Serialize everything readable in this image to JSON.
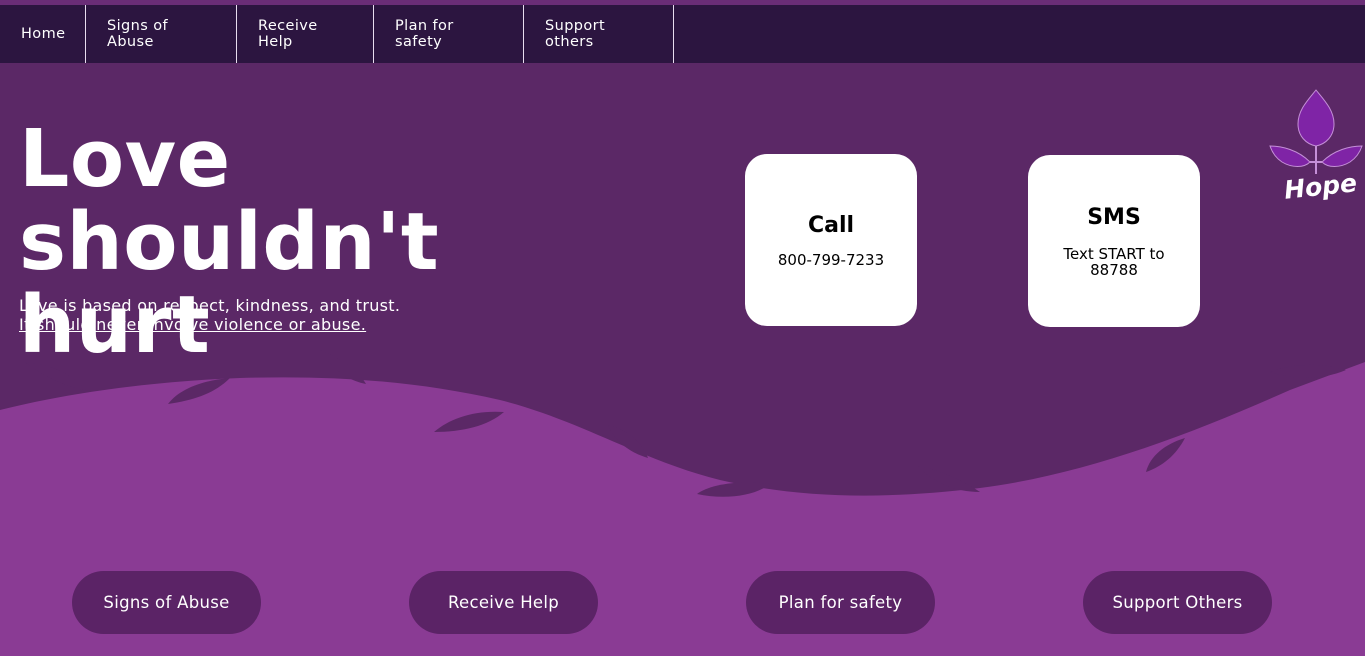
{
  "nav": {
    "items": [
      {
        "label": "Home"
      },
      {
        "label": "Signs of Abuse"
      },
      {
        "label": "Receive Help"
      },
      {
        "label": "Plan for safety"
      },
      {
        "label": "Support others"
      }
    ]
  },
  "hero": {
    "title": "Love shouldn't hurt",
    "lead_line1": "Love is based on respect, kindness, and trust.",
    "lead_line2": "It should never involve violence or abuse."
  },
  "contact": {
    "call": {
      "title": "Call",
      "text": "800-799-7233"
    },
    "sms": {
      "title": "SMS",
      "text": "Text START to 88788"
    }
  },
  "logo": {
    "wordmark": "Hope",
    "icon": "leaf-icon"
  },
  "buttons": [
    {
      "label": "Signs of Abuse"
    },
    {
      "label": "Receive Help"
    },
    {
      "label": "Plan for safety"
    },
    {
      "label": "Support Others"
    }
  ],
  "colors": {
    "background_dark": "#5b2866",
    "background_light": "#8a3b94",
    "nav_bg": "#2c1540",
    "pill_bg": "#5b2366",
    "logo_purple": "#7f24a6"
  }
}
